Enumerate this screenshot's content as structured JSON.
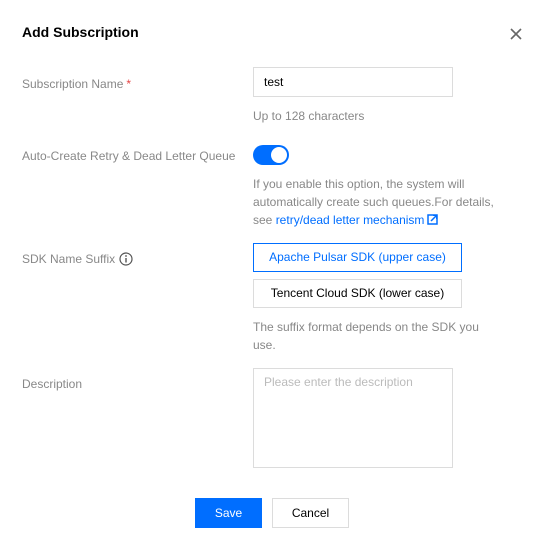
{
  "dialog": {
    "title": "Add Subscription"
  },
  "fields": {
    "subscription_name": {
      "label": "Subscription Name",
      "required_mark": "*",
      "value": "test",
      "hint": "Up to 128 characters"
    },
    "auto_create": {
      "label": "Auto-Create Retry & Dead Letter Queue",
      "enabled": true,
      "hint_line1": "If you enable this option, the system will",
      "hint_line2": "automatically create such queues.For details,",
      "hint_prefix": "see ",
      "hint_link": "retry/dead letter mechanism"
    },
    "sdk_suffix": {
      "label": "SDK Name Suffix",
      "options": [
        "Apache Pulsar SDK (upper case)",
        "Tencent Cloud SDK (lower case)"
      ],
      "selected": "Apache Pulsar SDK (upper case)",
      "hint_line1": "The suffix format depends on the SDK you",
      "hint_line2": "use."
    },
    "description": {
      "label": "Description",
      "placeholder": "Please enter the description",
      "value": ""
    }
  },
  "actions": {
    "save_label": "Save",
    "cancel_label": "Cancel"
  },
  "colors": {
    "accent": "#006eff",
    "required": "#e54545"
  },
  "icons": {
    "close": "close-icon",
    "info": "info-icon",
    "external_link": "external-link-icon"
  }
}
